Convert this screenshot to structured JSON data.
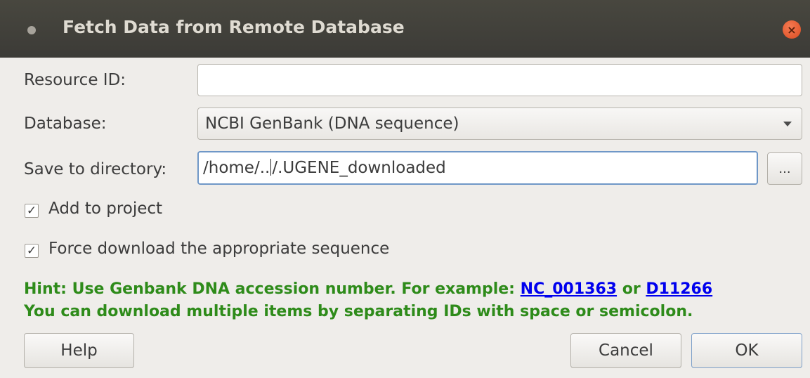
{
  "window": {
    "title": "Fetch Data from Remote Database",
    "close_glyph": "×"
  },
  "form": {
    "resource_id_label": "Resource ID:",
    "resource_id_value": "",
    "database_label": "Database:",
    "database_value": "NCBI GenBank (DNA sequence)",
    "save_label": "Save to directory:",
    "save_value_before_cursor": "/home/..",
    "save_value_after_cursor": "/.UGENE_downloaded",
    "browse_label": "...",
    "add_to_project_label": "Add to project",
    "add_to_project_checked": "✓",
    "force_download_label": "Force download the appropriate sequence",
    "force_download_checked": "✓"
  },
  "hint": {
    "line1_prefix": "Hint: Use Genbank DNA accession number. For example: ",
    "example1": "NC_001363",
    "or_text": " or ",
    "example2": "D11266",
    "line2": "You can download multiple items by separating IDs with space or semicolon.",
    "color": "#2e8b1a"
  },
  "buttons": {
    "help": "Help",
    "cancel": "Cancel",
    "ok": "OK"
  },
  "icons": {
    "title_dot": "window-menu-icon",
    "close": "close-icon",
    "combo_arrow": "chevron-down-icon"
  }
}
